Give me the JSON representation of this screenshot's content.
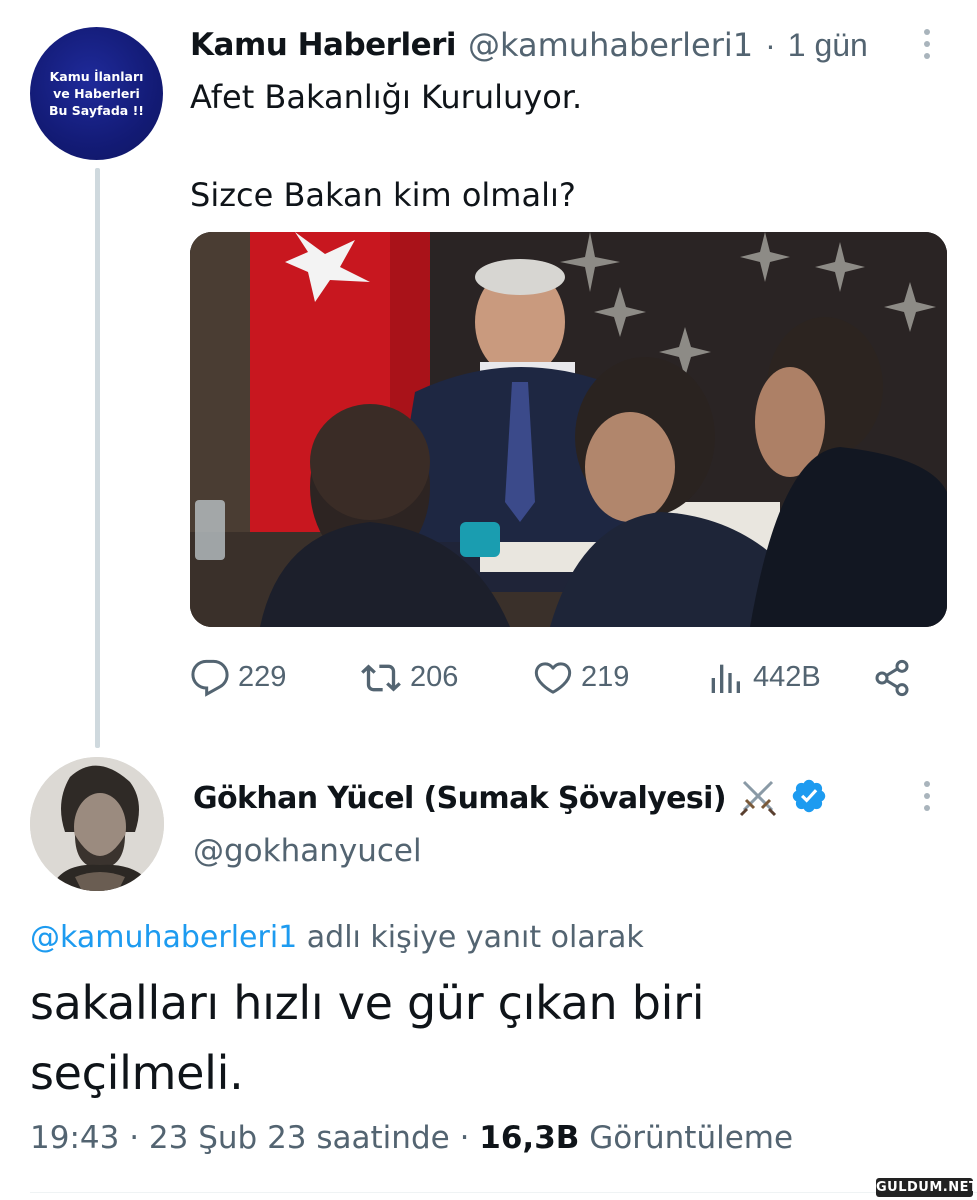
{
  "tweet1": {
    "avatar_text": "Kamu İlanları\nve Haberleri\nBu Sayfada !!",
    "display_name": "Kamu Haberleri",
    "handle": "@kamuhaberleri1",
    "separator": "·",
    "time": "1 gün",
    "text_line1": "Afet Bakanlığı Kuruluyor.",
    "text_line2": "Sizce Bakan kim olmalı?",
    "media_icon": "photo",
    "actions": {
      "replies": "229",
      "retweets": "206",
      "likes": "219",
      "views": "442B"
    },
    "icons": {
      "reply": "reply-bubble-icon",
      "retweet": "retweet-icon",
      "like": "heart-icon",
      "views": "bar-chart-icon",
      "share": "share-icon",
      "more": "more-vertical-icon"
    }
  },
  "tweet2": {
    "display_name": "Gökhan Yücel (Sumak Şövalyesi)",
    "name_emoji": "crossed-swords-icon",
    "verified": "verified-badge-icon",
    "handle": "@gokhanyucel",
    "reply_mention": "@kamuhaberleri1",
    "reply_suffix": " adlı kişiye yanıt olarak",
    "text": "sakalları hızlı ve gür çıkan biri seçilmeli.",
    "time": "19:43",
    "date": "23 Şub 23 saatinde",
    "separator": "·",
    "views_count": "16,3B",
    "views_label": "Görüntüleme"
  },
  "watermark": "GULDUM.NET",
  "colors": {
    "accent": "#1d9bf0",
    "secondary_text": "#536471",
    "primary_text": "#0f1419",
    "avatar_navy": "#131b76",
    "thread_line": "#cfd9de"
  }
}
